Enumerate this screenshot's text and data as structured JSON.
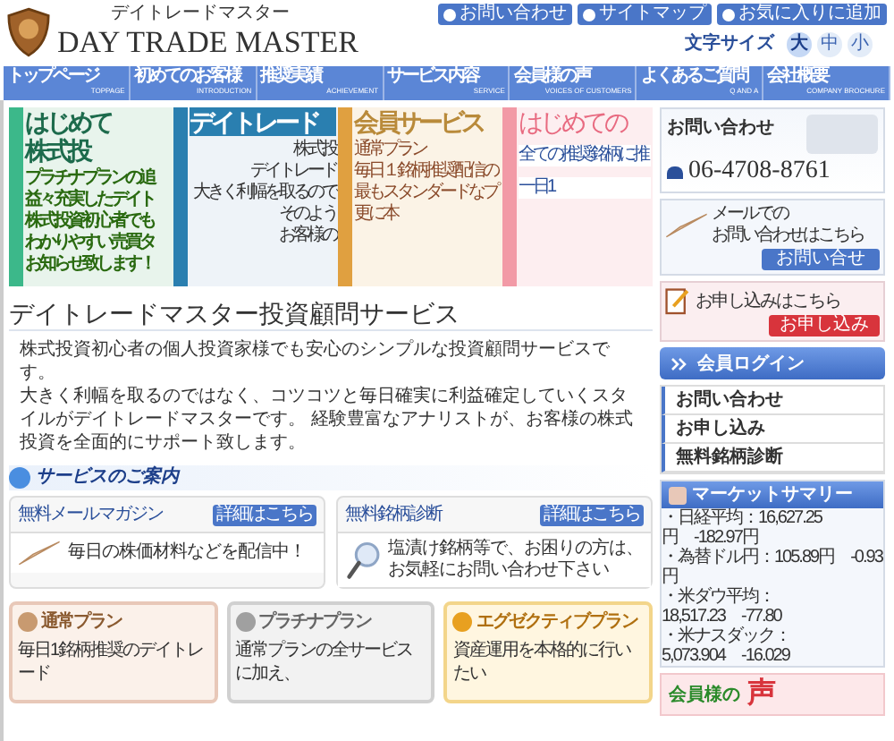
{
  "header": {
    "logo_kana": "デイトレードマスター",
    "logo_text": "DAY TRADE MASTER",
    "top_links": [
      "お問い合わせ",
      "サイトマップ",
      "お気に入りに追加"
    ],
    "font_size_label": "文字サイズ",
    "font_sizes": [
      {
        "label": "大",
        "selected": true
      },
      {
        "label": "中",
        "selected": false
      },
      {
        "label": "小",
        "selected": false
      }
    ]
  },
  "nav": [
    {
      "label": "トップページ",
      "sub": "TOPPAGE"
    },
    {
      "label": "初めてのお客様",
      "sub": "INTRODUCTION"
    },
    {
      "label": "推奨実績",
      "sub": "ACHIEVEMENT"
    },
    {
      "label": "サービス内容",
      "sub": "SERVICE"
    },
    {
      "label": "会員様の声",
      "sub": "VOICES OF CUSTOMERS"
    },
    {
      "label": "よくあるご質問",
      "sub": "Q AND A"
    },
    {
      "label": "会社概要",
      "sub": "COMPANY BROCHURE"
    }
  ],
  "banner": [
    {
      "kind": "beginner",
      "color": "#3cb88a",
      "titles": [
        "はじめて",
        "株式投"
      ],
      "lines": [
        "プラチナプランの追",
        "益々充実したデイト",
        "株式投資初心者でも",
        "わかりやすい売買タ",
        "お知らせ致します！"
      ]
    },
    {
      "kind": "about",
      "color": "#2a7fb0",
      "titles": [
        "デイトレード"
      ],
      "lines": [
        "株式投",
        "デイトレード",
        "大きく利幅を取るので",
        "そのよう",
        "お客様の"
      ]
    },
    {
      "kind": "service",
      "color": "#e0a040",
      "titles": [
        "会員サービス"
      ],
      "lines": [
        "通常プラン",
        "毎日１銘柄推奨配信の",
        "最もスタンダードなプ",
        "更に本"
      ]
    },
    {
      "kind": "first",
      "color": "#f29aa6",
      "titles": [
        "はじめての"
      ],
      "lines": [
        "全ての推奨銘柄に推",
        "一日1"
      ]
    }
  ],
  "intro": {
    "heading": "デイトレードマスター投資顧問サービス",
    "paragraphs": [
      "株式投資初心者の個人投資家様でも安心のシンプルな投資顧問サービスです。",
      "大きく利幅を取るのではなく、コツコツと毎日確実に利益確定していくスタイルがデイトレードマスターです。 経験豊富なアナリストが、お客様の株式投資を全面的にサポート致します。"
    ]
  },
  "services": {
    "heading": "サービスのご案内",
    "cards": [
      {
        "kind": "mail",
        "title": "無料メールマガジン",
        "button": "詳細はこちら",
        "text": "毎日の株価材料などを配信中！"
      },
      {
        "kind": "search",
        "title": "無料銘柄診断",
        "button": "詳細はこちら",
        "text": "塩漬け銘柄等で、お困りの方は、お気軽にお問い合わせ下さい"
      }
    ]
  },
  "plans": [
    {
      "kind": "regular",
      "name": "通常プラン",
      "lines": [
        "毎日1銘柄推奨のデイトレード"
      ]
    },
    {
      "kind": "platinum",
      "name": "プラチナプラン",
      "lines": [
        "通常プランの全サービスに加え、"
      ]
    },
    {
      "kind": "executive",
      "name": "エグゼクティブプラン",
      "lines": [
        "資産運用を本格的に行いたい"
      ]
    }
  ],
  "sidebar": {
    "contact": {
      "title": "お問い合わせ",
      "phone": "06-4708-8761"
    },
    "mail": {
      "lines": [
        "メールでの",
        "お問い合わせはこちら"
      ],
      "button": "お問い合せ"
    },
    "apply": {
      "text": "お申し込みはこちら",
      "button": "お申し込み"
    },
    "login": "会員ログイン",
    "menu": [
      "お問い合わせ",
      "お申し込み",
      "無料銘柄診断"
    ],
    "market": {
      "title": "マーケットサマリー",
      "lines": [
        "・日経平均：16,627.25円　-182.97円",
        "・為替ドル円：105.89円　-0.93円",
        "・米ダウ平均：18,517.23　-77.80",
        "・米ナスダック：5,073.904　-16.029"
      ]
    },
    "voice": {
      "label": "会員様の",
      "big": "声"
    }
  }
}
